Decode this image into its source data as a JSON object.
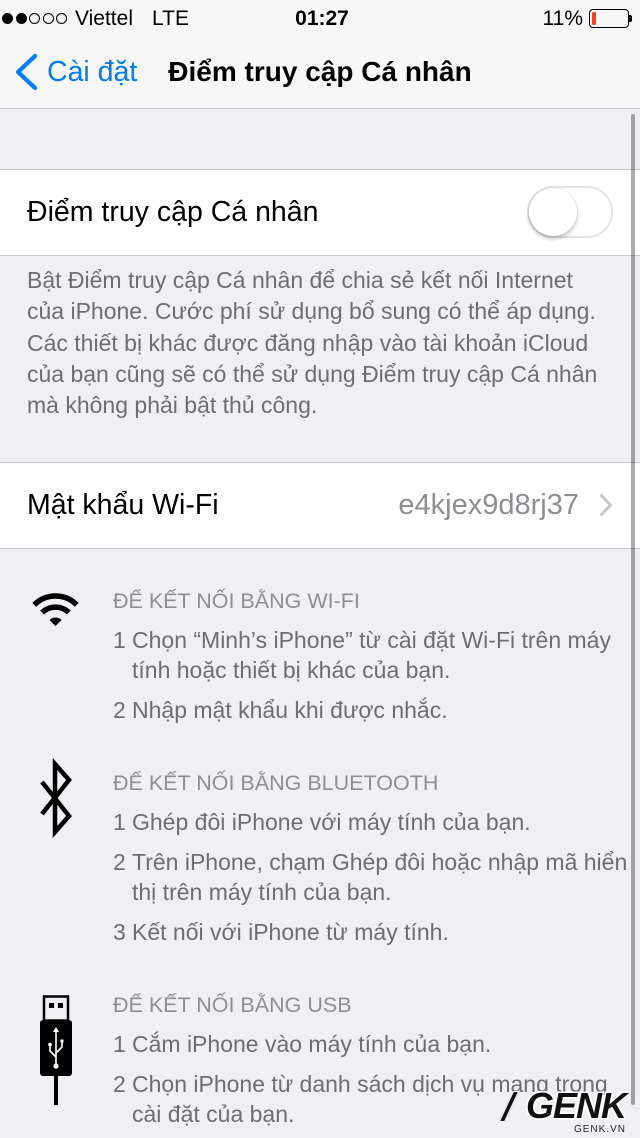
{
  "status_bar": {
    "signal_strength": 2,
    "signal_max": 5,
    "carrier": "Viettel",
    "network": "LTE",
    "time": "01:27",
    "battery_text": "11%",
    "battery_level": 0.11
  },
  "nav": {
    "back_icon": "chevron-left-icon",
    "back_label": "Cài đặt",
    "title": "Điểm truy cập Cá nhân"
  },
  "hotspot": {
    "label": "Điểm truy cập Cá nhân",
    "toggle_on": false,
    "footer_lines": [
      "Bật Điểm truy cập Cá nhân để chia sẻ kết nối Internet",
      "của iPhone. Cước phí sử dụng bổ sung có thể áp dụng.",
      "Các thiết bị khác được đăng nhập vào tài khoản iCloud",
      "của bạn cũng sẽ có thể sử dụng Điểm truy cập Cá nhân",
      "mà không phải bật thủ công."
    ]
  },
  "wifi_password": {
    "label": "Mật khẩu Wi-Fi",
    "value": "e4kjex9d8rj37",
    "chevron_icon": "chevron-right-icon"
  },
  "instructions": [
    {
      "icon": "wifi-icon",
      "header": "ĐỂ KẾT NỐI BẰNG WI-FI",
      "steps": [
        {
          "num": "1",
          "lines": [
            "Chọn “Minh’s iPhone” từ cài đặt Wi-Fi trên máy",
            "tính hoặc thiết bị khác của bạn."
          ]
        },
        {
          "num": "2",
          "lines": [
            "Nhập mật khẩu khi được nhắc."
          ]
        }
      ]
    },
    {
      "icon": "bluetooth-icon",
      "header": "ĐỂ KẾT NỐI BẰNG BLUETOOTH",
      "steps": [
        {
          "num": "1",
          "lines": [
            "Ghép đôi iPhone với máy tính của bạn."
          ]
        },
        {
          "num": "2",
          "lines": [
            "Trên iPhone, chạm Ghép đôi hoặc nhập mã hiển",
            "thị trên máy tính của bạn."
          ]
        },
        {
          "num": "3",
          "lines": [
            "Kết nối với iPhone từ máy tính."
          ]
        }
      ]
    },
    {
      "icon": "usb-icon",
      "header": "ĐỂ KẾT NỐI BẰNG USB",
      "steps": [
        {
          "num": "1",
          "lines": [
            "Cắm iPhone vào máy tính của bạn."
          ]
        },
        {
          "num": "2",
          "lines": [
            "Chọn iPhone từ danh sách dịch vụ mạng trong",
            "cài đặt của bạn."
          ]
        }
      ]
    }
  ],
  "watermark": {
    "logo": "GENK",
    "site": "GENK.VN"
  },
  "colors": {
    "accent": "#007aff",
    "battery_low": "#ff3b30",
    "background": "#efeff4",
    "secondary_text": "#6d6d72",
    "value_text": "#8e8e93"
  }
}
